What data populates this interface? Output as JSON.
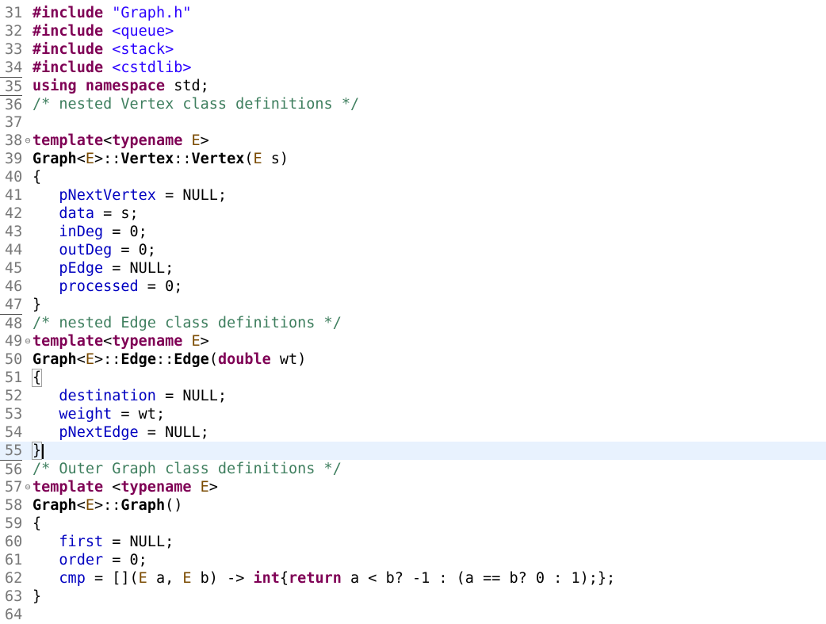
{
  "editor": {
    "lines": [
      {
        "n": "31",
        "fold": "",
        "rule": false,
        "current": false,
        "t": [
          [
            "kw",
            "#include"
          ],
          [
            "",
            " "
          ],
          [
            "str",
            "\"Graph.h\""
          ]
        ]
      },
      {
        "n": "32",
        "fold": "",
        "rule": false,
        "current": false,
        "t": [
          [
            "kw",
            "#include"
          ],
          [
            "",
            " "
          ],
          [
            "str",
            "<queue>"
          ]
        ]
      },
      {
        "n": "33",
        "fold": "",
        "rule": false,
        "current": false,
        "t": [
          [
            "kw",
            "#include"
          ],
          [
            "",
            " "
          ],
          [
            "str",
            "<stack>"
          ]
        ]
      },
      {
        "n": "34",
        "fold": "",
        "rule": false,
        "current": false,
        "t": [
          [
            "kw",
            "#include"
          ],
          [
            "",
            " "
          ],
          [
            "str",
            "<cstdlib>"
          ]
        ]
      },
      {
        "n": "35",
        "fold": "",
        "rule": true,
        "current": false,
        "t": [
          [
            "kw",
            "using namespace"
          ],
          [
            "",
            " std;"
          ]
        ]
      },
      {
        "n": "36",
        "fold": "",
        "rule": true,
        "current": false,
        "t": [
          [
            "cm",
            "/* nested Vertex class definitions */"
          ]
        ]
      },
      {
        "n": "37",
        "fold": "",
        "rule": false,
        "current": false,
        "t": []
      },
      {
        "n": "38",
        "fold": "⊖",
        "rule": false,
        "current": false,
        "t": [
          [
            "kw",
            "template"
          ],
          [
            "",
            "<"
          ],
          [
            "kw",
            "typename"
          ],
          [
            "",
            " "
          ],
          [
            "tp",
            "E"
          ],
          [
            "",
            ">"
          ]
        ]
      },
      {
        "n": "39",
        "fold": "",
        "rule": false,
        "current": false,
        "t": [
          [
            "bold",
            "Graph"
          ],
          [
            "",
            "<"
          ],
          [
            "tp",
            "E"
          ],
          [
            "",
            ">::"
          ],
          [
            "bold",
            "Vertex"
          ],
          [
            "",
            "::"
          ],
          [
            "bold",
            "Vertex"
          ],
          [
            "",
            "("
          ],
          [
            "tp",
            "E"
          ],
          [
            "",
            " s)"
          ]
        ]
      },
      {
        "n": "40",
        "fold": "",
        "rule": false,
        "current": false,
        "t": [
          [
            "",
            "{"
          ]
        ]
      },
      {
        "n": "41",
        "fold": "",
        "rule": false,
        "current": false,
        "t": [
          [
            "",
            "   "
          ],
          [
            "fld",
            "pNextVertex"
          ],
          [
            "",
            " = NULL;"
          ]
        ]
      },
      {
        "n": "42",
        "fold": "",
        "rule": false,
        "current": false,
        "t": [
          [
            "",
            "   "
          ],
          [
            "fld",
            "data"
          ],
          [
            "",
            " = s;"
          ]
        ]
      },
      {
        "n": "43",
        "fold": "",
        "rule": false,
        "current": false,
        "t": [
          [
            "",
            "   "
          ],
          [
            "fld",
            "inDeg"
          ],
          [
            "",
            " = 0;"
          ]
        ]
      },
      {
        "n": "44",
        "fold": "",
        "rule": false,
        "current": false,
        "t": [
          [
            "",
            "   "
          ],
          [
            "fld",
            "outDeg"
          ],
          [
            "",
            " = 0;"
          ]
        ]
      },
      {
        "n": "45",
        "fold": "",
        "rule": false,
        "current": false,
        "t": [
          [
            "",
            "   "
          ],
          [
            "fld",
            "pEdge"
          ],
          [
            "",
            " = NULL;"
          ]
        ]
      },
      {
        "n": "46",
        "fold": "",
        "rule": false,
        "current": false,
        "t": [
          [
            "",
            "   "
          ],
          [
            "fld",
            "processed"
          ],
          [
            "",
            " = 0;"
          ]
        ]
      },
      {
        "n": "47",
        "fold": "",
        "rule": false,
        "current": false,
        "t": [
          [
            "",
            "}"
          ]
        ]
      },
      {
        "n": "48",
        "fold": "",
        "rule": true,
        "current": false,
        "t": [
          [
            "cm",
            "/* nested Edge class definitions */"
          ]
        ]
      },
      {
        "n": "49",
        "fold": "⊖",
        "rule": false,
        "current": false,
        "t": [
          [
            "kw",
            "template"
          ],
          [
            "",
            "<"
          ],
          [
            "kw",
            "typename"
          ],
          [
            "",
            " "
          ],
          [
            "tp",
            "E"
          ],
          [
            "",
            ">"
          ]
        ]
      },
      {
        "n": "50",
        "fold": "",
        "rule": false,
        "current": false,
        "t": [
          [
            "bold",
            "Graph"
          ],
          [
            "",
            "<"
          ],
          [
            "tp",
            "E"
          ],
          [
            "",
            ">::"
          ],
          [
            "bold",
            "Edge"
          ],
          [
            "",
            "::"
          ],
          [
            "bold",
            "Edge"
          ],
          [
            "",
            "("
          ],
          [
            "kw",
            "double"
          ],
          [
            "",
            " wt)"
          ]
        ]
      },
      {
        "n": "51",
        "fold": "",
        "rule": false,
        "current": false,
        "t": [
          [
            "box",
            "{"
          ]
        ]
      },
      {
        "n": "52",
        "fold": "",
        "rule": false,
        "current": false,
        "t": [
          [
            "",
            "   "
          ],
          [
            "fld",
            "destination"
          ],
          [
            "",
            " = NULL;"
          ]
        ]
      },
      {
        "n": "53",
        "fold": "",
        "rule": false,
        "current": false,
        "t": [
          [
            "",
            "   "
          ],
          [
            "fld",
            "weight"
          ],
          [
            "",
            " = wt;"
          ]
        ]
      },
      {
        "n": "54",
        "fold": "",
        "rule": false,
        "current": false,
        "t": [
          [
            "",
            "   "
          ],
          [
            "fld",
            "pNextEdge"
          ],
          [
            "",
            " = NULL;"
          ]
        ]
      },
      {
        "n": "55",
        "fold": "",
        "rule": false,
        "current": true,
        "t": [
          [
            "box",
            "}"
          ],
          [
            "caret",
            ""
          ]
        ]
      },
      {
        "n": "56",
        "fold": "",
        "rule": true,
        "current": false,
        "t": [
          [
            "cm",
            "/* Outer Graph class definitions */"
          ]
        ]
      },
      {
        "n": "57",
        "fold": "⊖",
        "rule": false,
        "current": false,
        "t": [
          [
            "kw",
            "template"
          ],
          [
            "",
            " <"
          ],
          [
            "kw",
            "typename"
          ],
          [
            "",
            " "
          ],
          [
            "tp",
            "E"
          ],
          [
            "",
            ">"
          ]
        ]
      },
      {
        "n": "58",
        "fold": "",
        "rule": false,
        "current": false,
        "t": [
          [
            "bold",
            "Graph"
          ],
          [
            "",
            "<"
          ],
          [
            "tp",
            "E"
          ],
          [
            "",
            ">::"
          ],
          [
            "bold",
            "Graph"
          ],
          [
            "",
            "()"
          ]
        ]
      },
      {
        "n": "59",
        "fold": "",
        "rule": false,
        "current": false,
        "t": [
          [
            "",
            "{"
          ]
        ]
      },
      {
        "n": "60",
        "fold": "",
        "rule": false,
        "current": false,
        "t": [
          [
            "",
            "   "
          ],
          [
            "fld",
            "first"
          ],
          [
            "",
            " = NULL;"
          ]
        ]
      },
      {
        "n": "61",
        "fold": "",
        "rule": false,
        "current": false,
        "t": [
          [
            "",
            "   "
          ],
          [
            "fld",
            "order"
          ],
          [
            "",
            " = 0;"
          ]
        ]
      },
      {
        "n": "62",
        "fold": "",
        "rule": false,
        "current": false,
        "t": [
          [
            "",
            "   "
          ],
          [
            "fld",
            "cmp"
          ],
          [
            "",
            " = []("
          ],
          [
            "tp",
            "E"
          ],
          [
            "",
            " a, "
          ],
          [
            "tp",
            "E"
          ],
          [
            "",
            " b) -> "
          ],
          [
            "kw",
            "int"
          ],
          [
            "",
            "{"
          ],
          [
            "kw",
            "return"
          ],
          [
            "",
            " a < b? -1 : (a == b? 0 : 1);};"
          ]
        ]
      },
      {
        "n": "63",
        "fold": "",
        "rule": false,
        "current": false,
        "t": [
          [
            "",
            "}"
          ]
        ]
      },
      {
        "n": "64",
        "fold": "",
        "rule": false,
        "current": false,
        "t": []
      }
    ]
  }
}
